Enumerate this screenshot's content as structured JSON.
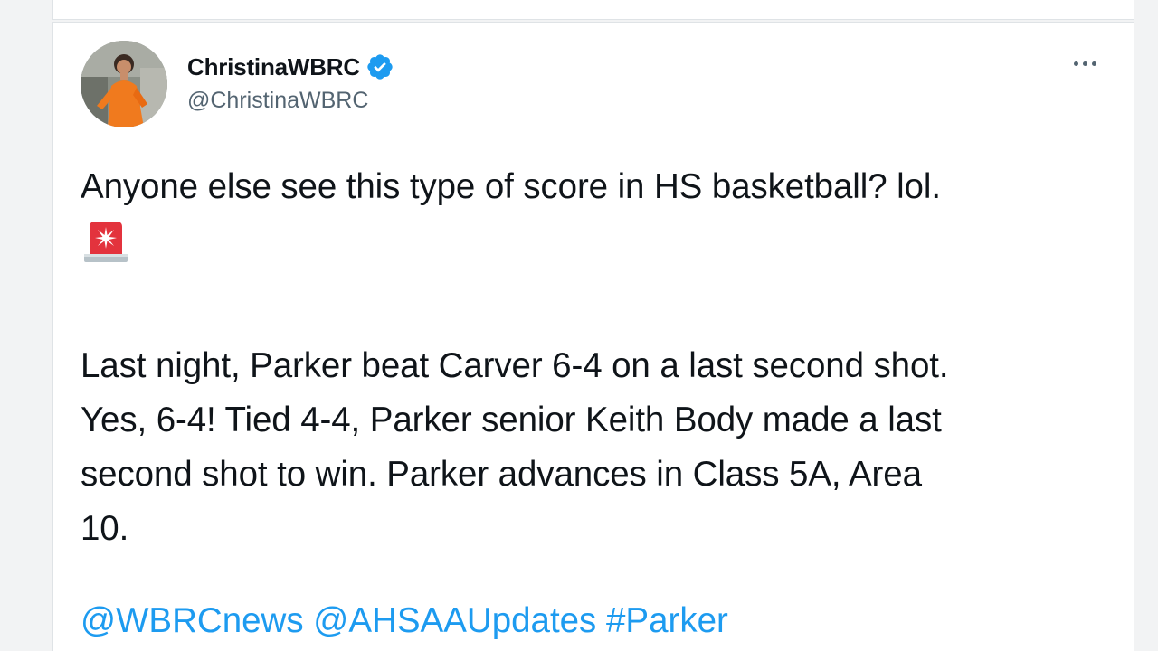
{
  "tweet": {
    "display_name": "ChristinaWBRC",
    "handle": "@ChristinaWBRC",
    "verified": true,
    "lines": [
      "Anyone else see this type of score in HS basketball? lol.",
      "Last night, Parker beat Carver 6-4 on a last second shot.",
      "Yes, 6-4! Tied 4-4,  Parker senior Keith Body made a last",
      "second shot to win. Parker advances in Class 5A, Area",
      "10."
    ],
    "emoji": "rotating-light-icon",
    "mentions": [
      "@WBRCnews",
      "@AHSAAUpdates",
      "#Parker"
    ]
  },
  "colors": {
    "text": "#0f1419",
    "secondary": "#536471",
    "link": "#1d9bf0",
    "verified": "#1d9bf0",
    "avatar_outfit": "#f07a1e"
  }
}
